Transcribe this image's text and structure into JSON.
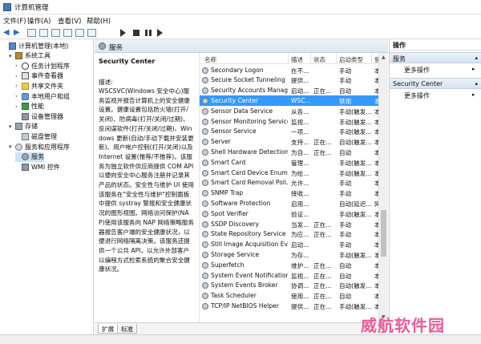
{
  "window": {
    "title": "计算机管理"
  },
  "menu": [
    "文件(F)",
    "操作(A)",
    "查看(V)",
    "帮助(H)"
  ],
  "tree": [
    {
      "label": "计算机管理(本地)",
      "icon": "computer-icon",
      "indent": 0,
      "expander": ""
    },
    {
      "label": "系统工具",
      "icon": "tools-icon",
      "indent": 1,
      "expander": "▾"
    },
    {
      "label": "任务计划程序",
      "icon": "clock-icon",
      "indent": 2,
      "expander": "›"
    },
    {
      "label": "事件查看器",
      "icon": "event-icon",
      "indent": 2,
      "expander": "›"
    },
    {
      "label": "共享文件夹",
      "icon": "folder-icon",
      "indent": 2,
      "expander": "›"
    },
    {
      "label": "本地用户和组",
      "icon": "users-icon",
      "indent": 2,
      "expander": "›"
    },
    {
      "label": "性能",
      "icon": "performance-icon",
      "indent": 2,
      "expander": "›"
    },
    {
      "label": "设备管理器",
      "icon": "device-icon",
      "indent": 2,
      "expander": ""
    },
    {
      "label": "存储",
      "icon": "storage-icon",
      "indent": 1,
      "expander": "▾"
    },
    {
      "label": "磁盘管理",
      "icon": "disk-icon",
      "indent": 2,
      "expander": ""
    },
    {
      "label": "服务和应用程序",
      "icon": "services-apps-icon",
      "indent": 1,
      "expander": "▾"
    },
    {
      "label": "服务",
      "icon": "services-icon",
      "indent": 2,
      "expander": "",
      "selected": true
    },
    {
      "label": "WMI 控件",
      "icon": "wmi-icon",
      "indent": 2,
      "expander": ""
    }
  ],
  "center": {
    "header": "服务",
    "service_title": "Security Center",
    "description_label": "描述:",
    "description": "WSCSVC(Windows 安全中心)服务监视并报告计算机上的安全健康设置。健康设置包括防火墙(打开/关闭)、防病毒(打开/关闭/过期)、反间谍软件(打开/关闭/过期)、Windows 更新(自动/手动下载并安装更新)、用户帐户控制(打开/关闭)以及 Internet 设置(推荐/不推荐)。该服务为独立软件供应商提供 COM API 以便向安全中心服务注册并记录其产品的状态。安全性与维护 UI 使用该服务在\"安全性与维护\"控制面板中提供 systray 警报和安全健康状况的图形视图。网络访问保护(NAP)使用该服务向 NAP 网络策略服务器报告客户端的安全健康状况，以便进行网络隔离决策。该服务还提供一个公共 API，以允许外部客户以编程方式检索系统的聚合安全健康状况。"
  },
  "columns": [
    "名称",
    "描述",
    "状态",
    "启动类型",
    "登"
  ],
  "services": [
    {
      "name": "Secondary Logon",
      "desc": "在不...",
      "status": "",
      "startup": "手动",
      "logon": "本"
    },
    {
      "name": "Secure Socket Tunneling ...",
      "desc": "提供...",
      "status": "",
      "startup": "手动",
      "logon": "本"
    },
    {
      "name": "Security Accounts Manag...",
      "desc": "启动...",
      "status": "正在...",
      "startup": "自动",
      "logon": "本"
    },
    {
      "name": "Security Center",
      "desc": "WSC...",
      "status": "",
      "startup": "禁用",
      "logon": "本",
      "selected": true
    },
    {
      "name": "Sensor Data Service",
      "desc": "从各...",
      "status": "",
      "startup": "手动(触发...",
      "logon": "本"
    },
    {
      "name": "Sensor Monitoring Service",
      "desc": "监视...",
      "status": "",
      "startup": "手动(触发...",
      "logon": "本"
    },
    {
      "name": "Sensor Service",
      "desc": "一项...",
      "status": "",
      "startup": "手动(触发...",
      "logon": "本"
    },
    {
      "name": "Server",
      "desc": "支持...",
      "status": "正在...",
      "startup": "自动(触发...",
      "logon": "本"
    },
    {
      "name": "Shell Hardware Detection",
      "desc": "为自...",
      "status": "正在...",
      "startup": "自动",
      "logon": "本"
    },
    {
      "name": "Smart Card",
      "desc": "管理...",
      "status": "",
      "startup": "手动(触发...",
      "logon": "本"
    },
    {
      "name": "Smart Card Device Enum...",
      "desc": "为给...",
      "status": "",
      "startup": "手动(触发...",
      "logon": "本"
    },
    {
      "name": "Smart Card Removal Poli...",
      "desc": "允许...",
      "status": "",
      "startup": "手动",
      "logon": "本"
    },
    {
      "name": "SNMP Trap",
      "desc": "接收...",
      "status": "",
      "startup": "手动",
      "logon": "本"
    },
    {
      "name": "Software Protection",
      "desc": "启用...",
      "status": "",
      "startup": "自动(延迟...",
      "logon": "网"
    },
    {
      "name": "Spot Verifier",
      "desc": "验证...",
      "status": "",
      "startup": "手动(触发...",
      "logon": "本"
    },
    {
      "name": "SSDP Discovery",
      "desc": "当发...",
      "status": "正在...",
      "startup": "手动",
      "logon": "本"
    },
    {
      "name": "State Repository Service",
      "desc": "为应...",
      "status": "正在...",
      "startup": "手动",
      "logon": "本"
    },
    {
      "name": "Still Image Acquisition Ev...",
      "desc": "启动...",
      "status": "",
      "startup": "手动",
      "logon": "本"
    },
    {
      "name": "Storage Service",
      "desc": "为存...",
      "status": "",
      "startup": "手动(触发...",
      "logon": "本"
    },
    {
      "name": "Superfetch",
      "desc": "维护...",
      "status": "正在...",
      "startup": "自动",
      "logon": "本"
    },
    {
      "name": "System Event Notification...",
      "desc": "监视...",
      "status": "正在...",
      "startup": "自动",
      "logon": "本"
    },
    {
      "name": "System Events Broker",
      "desc": "协调...",
      "status": "正在...",
      "startup": "自动(触发...",
      "logon": "本"
    },
    {
      "name": "Task Scheduler",
      "desc": "使用...",
      "status": "正在...",
      "startup": "自动",
      "logon": "本"
    },
    {
      "name": "TCP/IP NetBIOS Helper",
      "desc": "提供...",
      "status": "正在...",
      "startup": "手动(触发...",
      "logon": "本"
    }
  ],
  "tabs": [
    "扩展",
    "标准"
  ],
  "actions": {
    "title": "操作",
    "groups": [
      {
        "label": "服务",
        "items": [
          "更多操作"
        ]
      },
      {
        "label": "Security Center",
        "items": [
          "更多操作"
        ]
      }
    ]
  },
  "watermark": "威航软件园"
}
